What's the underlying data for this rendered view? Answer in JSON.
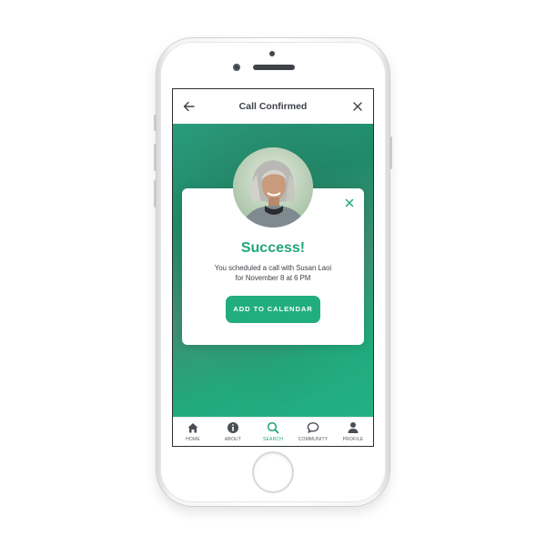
{
  "header": {
    "title": "Call Confirmed",
    "back_icon": "arrow-left-icon",
    "close_icon": "close-icon"
  },
  "dialog": {
    "heading": "Success!",
    "message_line1": "You scheduled a call with Susan Laoi",
    "message_line2": "for November 8 at 6 PM",
    "button_label": "ADD TO CALENDAR",
    "close_icon": "close-icon",
    "avatar_icon": "avatar"
  },
  "tabs": [
    {
      "label": "HOME",
      "icon": "home-icon"
    },
    {
      "label": "ABOUT",
      "icon": "info-icon"
    },
    {
      "label": "SEARCH",
      "icon": "search-icon",
      "active": true
    },
    {
      "label": "COMMUNITY",
      "icon": "chat-bubble-icon"
    },
    {
      "label": "PROFILE",
      "icon": "person-icon"
    }
  ],
  "colors": {
    "accent": "#21a77a",
    "background_gradient_top": "#1f8a69",
    "background_gradient_bottom": "#23b083",
    "text_dark": "#3d4148"
  }
}
